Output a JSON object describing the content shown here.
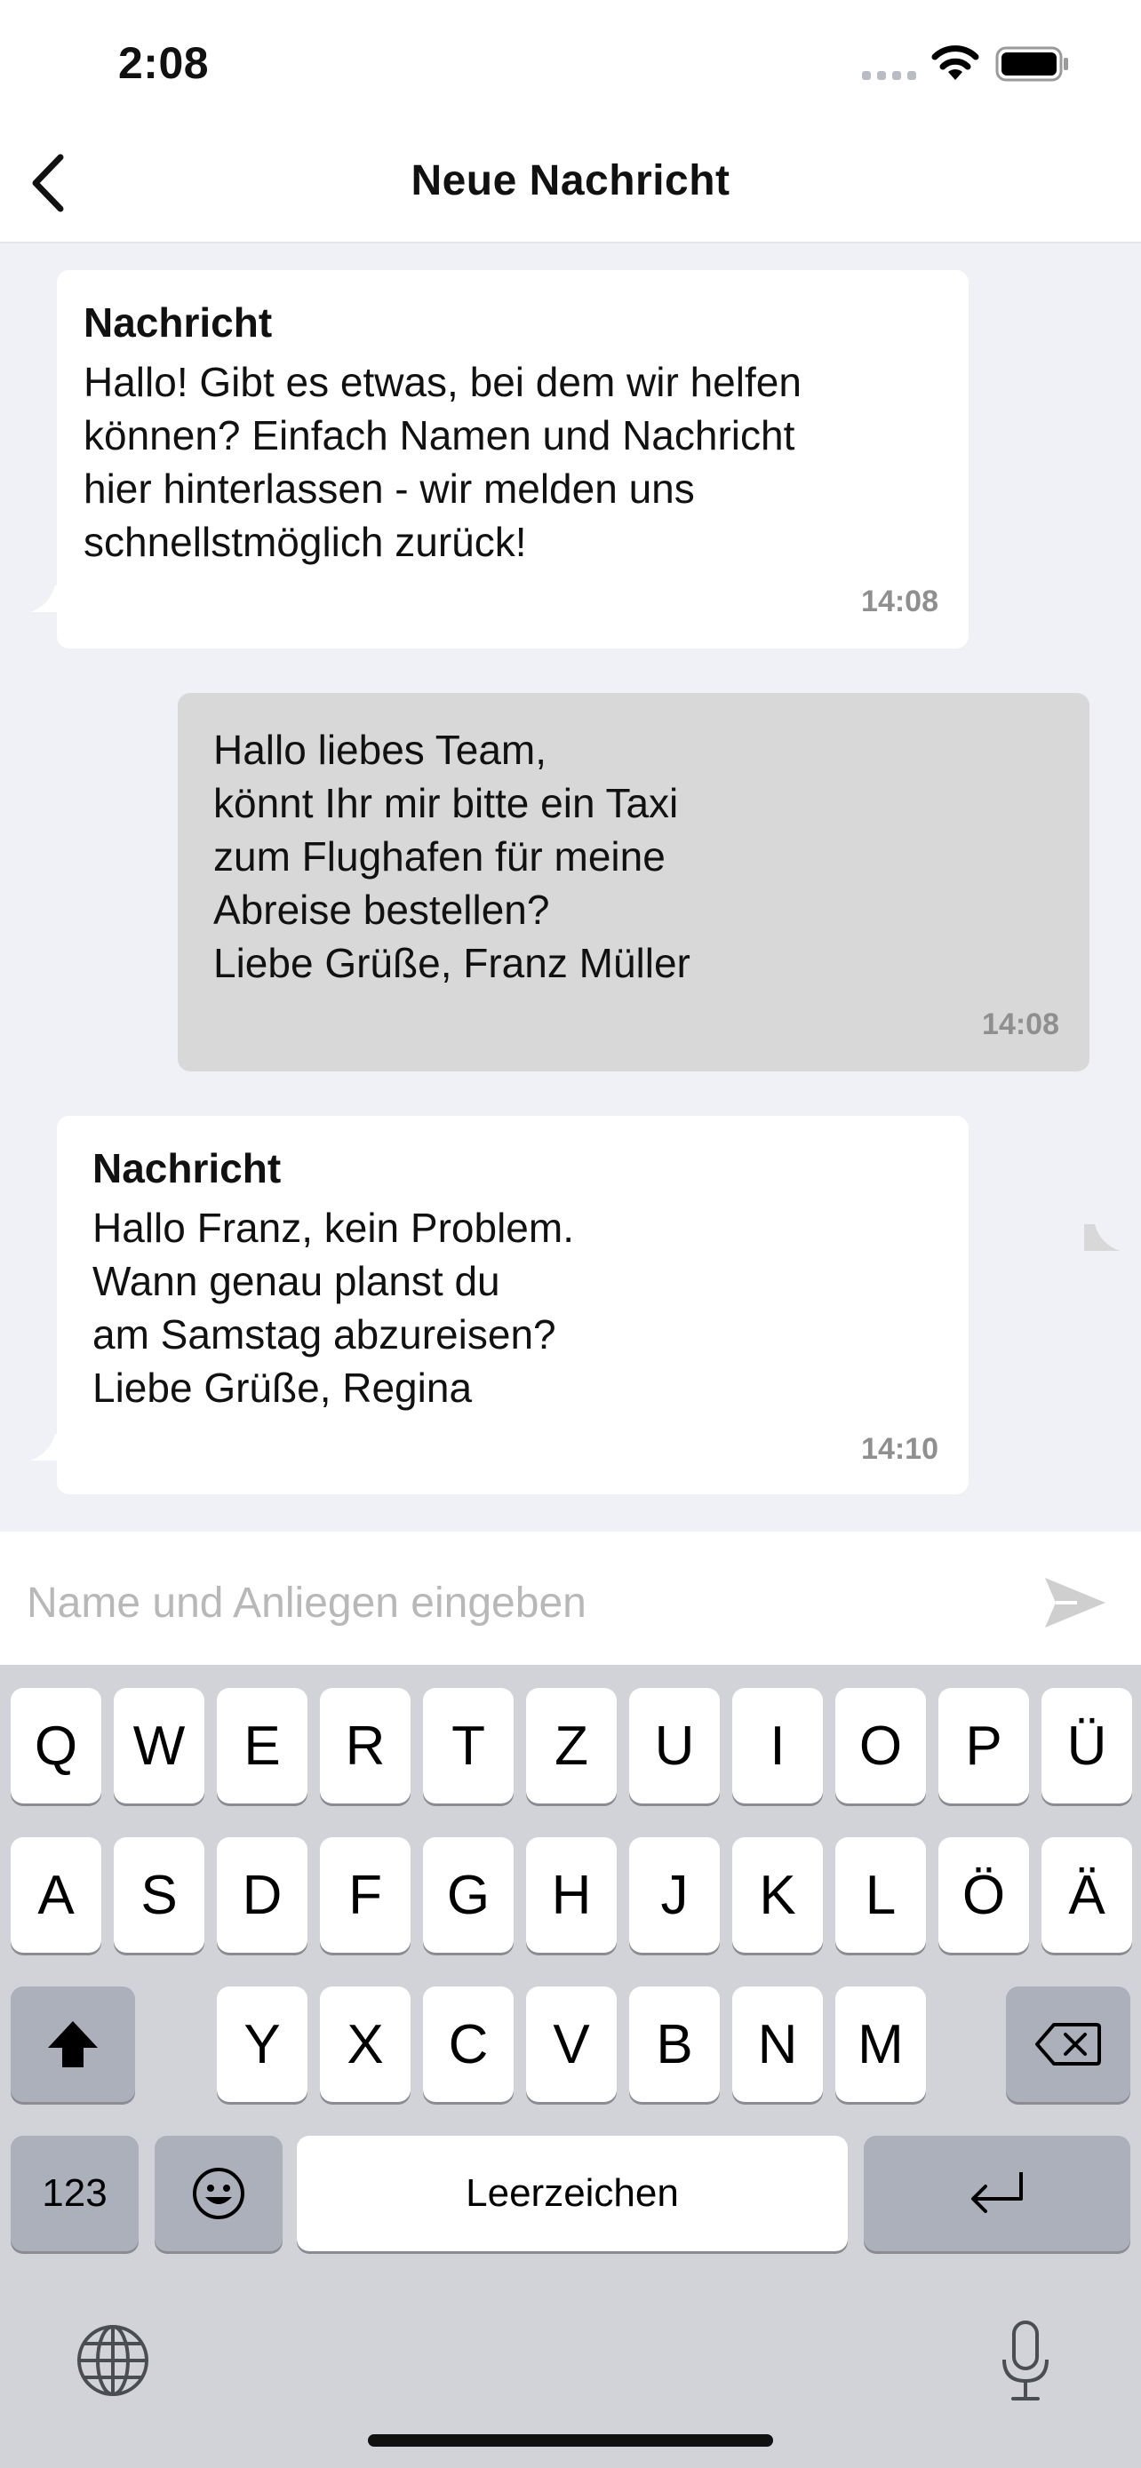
{
  "status_bar": {
    "time": "2:08"
  },
  "header": {
    "title": "Neue Nachricht"
  },
  "messages": [
    {
      "direction": "incoming",
      "sender": "Nachricht",
      "text": "Hallo! Gibt es etwas, bei dem wir helfen\nkönnen? Einfach Namen und Nachricht\nhier hinterlassen - wir melden uns\nschnellstmöglich zurück!",
      "time": "14:08"
    },
    {
      "direction": "outgoing",
      "text": "Hallo liebes Team,\nkönnt Ihr mir bitte ein Taxi\nzum Flughafen für meine\nAbreise bestellen?\nLiebe Grüße, Franz Müller",
      "time": "14:08"
    },
    {
      "direction": "incoming",
      "sender": "Nachricht",
      "text": "Hallo Franz, kein Problem.\nWann genau planst du\nam Samstag abzureisen?\nLiebe Grüße, Regina",
      "time": "14:10"
    }
  ],
  "composer": {
    "placeholder": "Name und Anliegen eingeben",
    "value": ""
  },
  "keyboard": {
    "row1": [
      "Q",
      "W",
      "E",
      "R",
      "T",
      "Z",
      "U",
      "I",
      "O",
      "P",
      "Ü"
    ],
    "row2": [
      "A",
      "S",
      "D",
      "F",
      "G",
      "H",
      "J",
      "K",
      "L",
      "Ö",
      "Ä"
    ],
    "row3": [
      "Y",
      "X",
      "C",
      "V",
      "B",
      "N",
      "M"
    ],
    "numbers_label": "123",
    "space_label": "Leerzeichen"
  },
  "colors": {
    "background": "#eff1f6",
    "incoming_bubble": "#ffffff",
    "outgoing_bubble": "#d8d8d8",
    "keyboard": "#d1d3d9",
    "special_key": "#abb0ba"
  },
  "icons": [
    "back-chevron-icon",
    "wifi-icon",
    "battery-icon",
    "send-icon",
    "shift-icon",
    "backspace-icon",
    "emoji-icon",
    "return-icon",
    "globe-icon",
    "microphone-icon"
  ]
}
